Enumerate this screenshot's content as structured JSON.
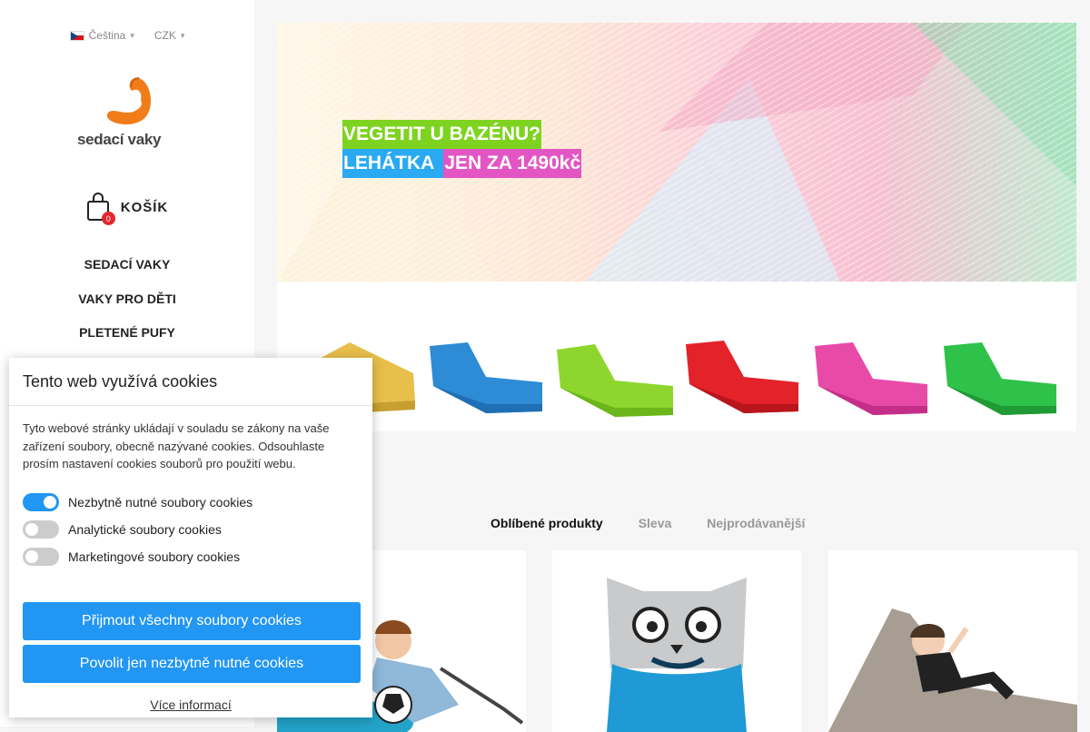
{
  "topbar": {
    "language": "Čeština",
    "currency": "CZK"
  },
  "logo": {
    "text": "sedací vaky"
  },
  "cart": {
    "label": "KOŠÍK",
    "count": "0"
  },
  "nav": {
    "items": [
      "SEDACÍ VAKY",
      "VAKY PRO DĚTI",
      "PLETENÉ PUFY"
    ]
  },
  "banner": {
    "line1": "VEGETIT U BAZÉNU?",
    "line2a": "LEHÁTKA ",
    "line2b": "JEN ZA 1490kč",
    "colors": {
      "green": "#7ed321",
      "blue": "#29aaf2",
      "pink": "#e455c4"
    }
  },
  "products": {
    "tabs": [
      "Oblíbené produkty",
      "Sleva",
      "Nejprodávanější"
    ],
    "active_tab": "Oblíbené produkty"
  },
  "cookies": {
    "title": "Tento web využívá cookies",
    "text": "Tyto webové stránky ukládají v souladu se zákony na vaše zařízení soubory, obecně nazývané cookies. Odsouhlaste prosím nastavení cookies souborů pro použití webu.",
    "options": [
      {
        "label": "Nezbytně nutné soubory cookies",
        "on": true
      },
      {
        "label": "Analytické soubory cookies",
        "on": false
      },
      {
        "label": "Marketingové soubory cookies",
        "on": false
      }
    ],
    "accept_all": "Přijmout všechny soubory cookies",
    "accept_necessary": "Povolit jen nezbytně nutné cookies",
    "more": "Více informací"
  },
  "accent_color": "#2196f3"
}
